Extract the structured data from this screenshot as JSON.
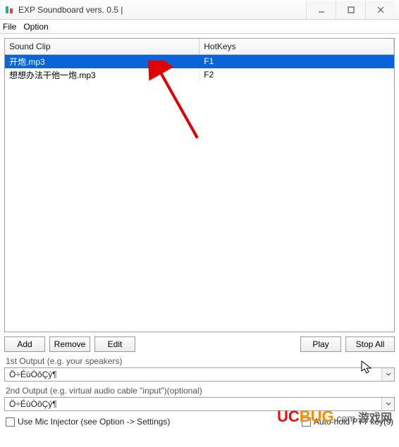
{
  "window": {
    "title": "EXP Soundboard vers. 0.5 |"
  },
  "menu": {
    "file": "File",
    "option": "Option"
  },
  "table": {
    "headers": {
      "soundclip": "Sound Clip",
      "hotkeys": "HotKeys"
    },
    "rows": [
      {
        "clip": "开炮.mp3",
        "hotkey": "F1",
        "selected": true
      },
      {
        "clip": "想想办法干他一炮.mp3",
        "hotkey": "F2",
        "selected": false
      }
    ]
  },
  "buttons": {
    "add": "Add",
    "remove": "Remove",
    "edit": "Edit",
    "play": "Play",
    "stopall": "Stop All"
  },
  "outputs": {
    "label1": "1st Output (e.g. your speakers)",
    "value1": "Ö÷ÉùÒôÇý¶",
    "label2": "2nd Output (e.g. virtual audio cable \"input\")(optional)",
    "value2": "Ö÷ÉùÒôÇý¶"
  },
  "checks": {
    "mic": "Use Mic Injector (see Option -> Settings)",
    "autohold": "Auto-hold PTT key(s)"
  },
  "watermark": {
    "uc": "UC",
    "bug": "BUG",
    "com": ".com",
    "cn": "游戏网"
  }
}
